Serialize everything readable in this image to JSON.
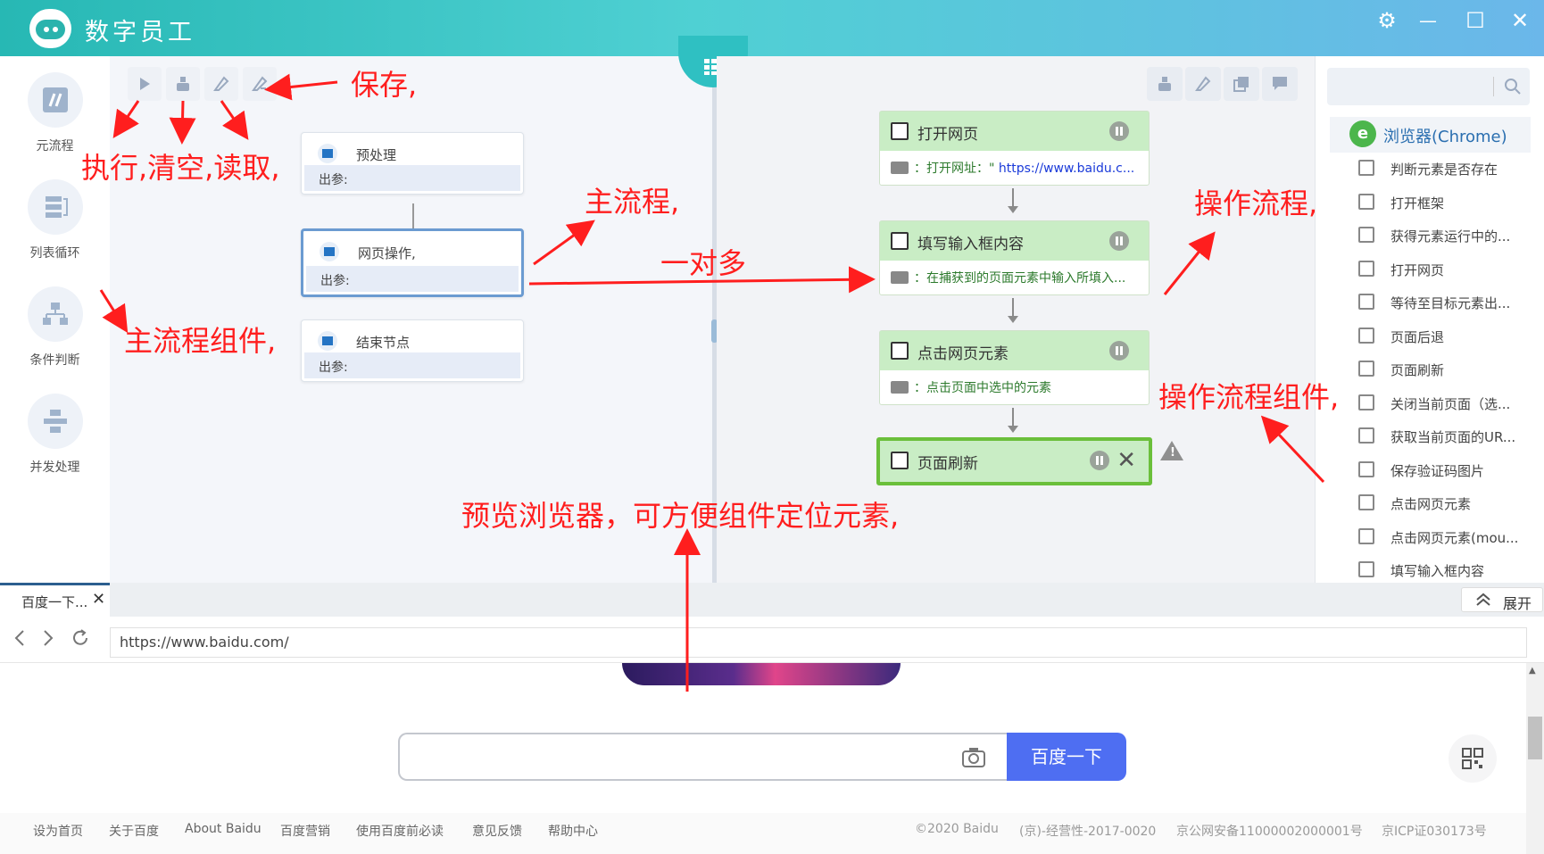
{
  "app": {
    "title": "数字员工"
  },
  "window_controls": {
    "settings": "⚙",
    "minimize": "—",
    "maximize": "☐",
    "close": "✕"
  },
  "left_panel": {
    "items": [
      {
        "label": "元流程",
        "icon": "meta-flow-icon"
      },
      {
        "label": "列表循环",
        "icon": "list-loop-icon"
      },
      {
        "label": "条件判断",
        "icon": "condition-icon"
      },
      {
        "label": "并发处理",
        "icon": "parallel-icon"
      }
    ]
  },
  "main_canvas": {
    "toolbar": [
      "execute",
      "clear",
      "read",
      "save"
    ],
    "nodes": [
      {
        "title": "预处理",
        "out_label": "出参:"
      },
      {
        "title": "网页操作,",
        "out_label": "出参:",
        "selected": true
      },
      {
        "title": "结束节点",
        "out_label": "出参:"
      }
    ]
  },
  "op_canvas": {
    "nodes": [
      {
        "title": "打开网页",
        "desc_prefix": "：打开网址：\"",
        "desc_url": " https://www.baidu.c..."
      },
      {
        "title": "填写输入框内容",
        "desc_prefix": "：在捕获到的页面元素中输入所填入...",
        "desc_url": ""
      },
      {
        "title": "点击网页元素",
        "desc_prefix": "：点击页面中选中的元素",
        "desc_url": ""
      },
      {
        "title": "页面刷新"
      }
    ],
    "warning": "!"
  },
  "right_panel": {
    "search_placeholder": "",
    "header": "浏览器(Chrome)",
    "items": [
      "判断元素是否存在",
      "打开框架",
      "获得元素运行中的...",
      "打开网页",
      "等待至目标元素出...",
      "页面后退",
      "页面刷新",
      "关闭当前页面（选...",
      "获取当前页面的UR...",
      "保存验证码图片",
      "点击网页元素",
      "点击网页元素(mou...",
      "填写输入框内容"
    ]
  },
  "browser": {
    "tab_title": "百度一下...",
    "tab_close": "✕",
    "expand_label": "展开",
    "url": "https://www.baidu.com/",
    "search_button": "百度一下",
    "footer_links": [
      "设为首页",
      "关于百度",
      "About Baidu",
      "百度营销",
      "使用百度前必读",
      "意见反馈",
      "帮助中心"
    ],
    "footer_info": [
      "©2020 Baidu",
      "(京)-经营性-2017-0020",
      "京公网安备11000002000001号",
      "京ICP证030173号"
    ]
  },
  "annotations": {
    "save": "保存,",
    "execute_clear_read": "执行,清空,读取,",
    "main_flow": "主流程,",
    "one_to_many": "一对多",
    "main_flow_components": "主流程组件,",
    "op_flow": "操作流程,",
    "op_flow_components": "操作流程组件,",
    "preview_browser": "预览浏览器，可方便组件定位元素,"
  }
}
